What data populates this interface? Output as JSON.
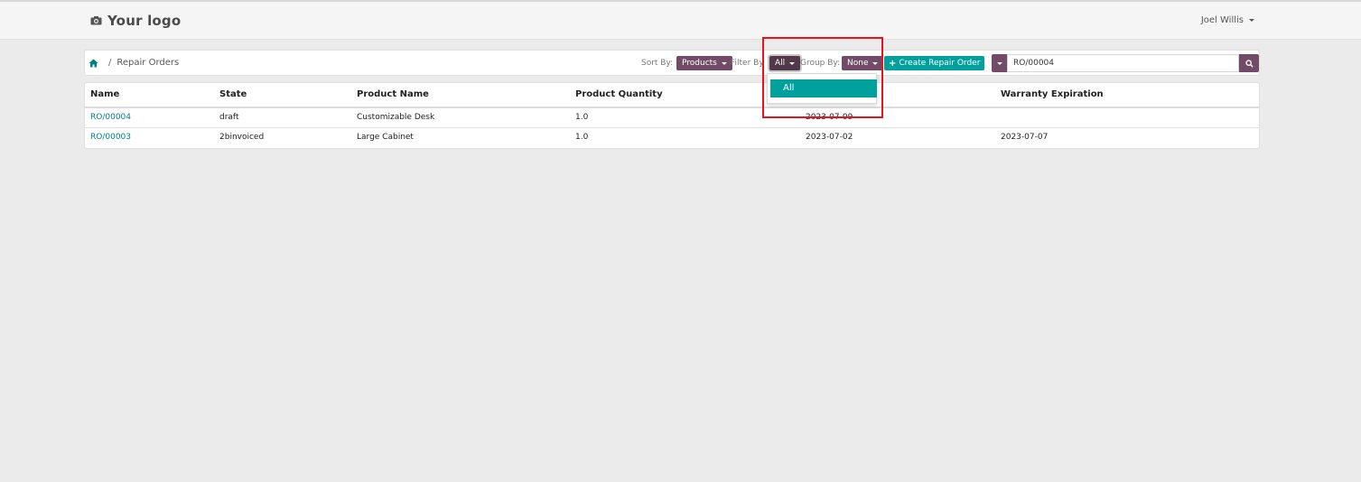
{
  "navbar": {
    "logo_text": "Your logo",
    "user_name": "Joel Willis"
  },
  "breadcrumb": {
    "current": "Repair Orders"
  },
  "toolbar": {
    "sort_label": "Sort By:",
    "sort_value": "Products",
    "filter_label": "Filter By",
    "filter_value": "All",
    "group_label": "Group By:",
    "group_value": "None",
    "create_label": "Create Repair Order",
    "search_value": "RO/00004"
  },
  "filter_dropdown": {
    "options": [
      "All"
    ]
  },
  "table": {
    "columns": [
      "Name",
      "State",
      "Product Name",
      "Product Quantity",
      "Warranty Expiration"
    ],
    "rows": [
      {
        "name": "RO/00004",
        "state": "draft",
        "product": "Customizable Desk",
        "qty": "1.0",
        "date": "2023-07-09",
        "warranty": ""
      },
      {
        "name": "RO/00003",
        "state": "2binvoiced",
        "product": "Large Cabinet",
        "qty": "1.0",
        "date": "2023-07-02",
        "warranty": "2023-07-07"
      }
    ]
  },
  "colors": {
    "primary": "#714b67",
    "accent": "#00a09d",
    "link": "#017e84",
    "highlight": "#e8141b"
  }
}
